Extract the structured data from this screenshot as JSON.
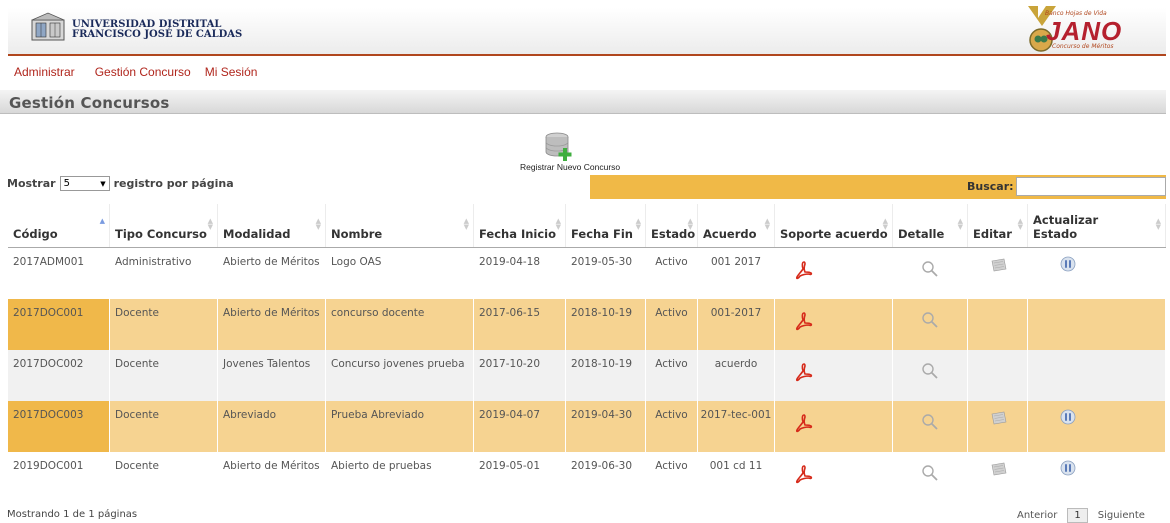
{
  "header": {
    "university_line1": "UNIVERSIDAD DISTRITAL",
    "university_line2": "FRANCISCO JOSÉ DE CALDAS",
    "jano_tagline": "Banco Hojas de Vida",
    "jano_title": "JANO",
    "jano_subtitle": "Concurso de Méritos"
  },
  "menu": {
    "items": [
      "Administrar",
      "Gestión Concurso",
      "Mi Sesión"
    ]
  },
  "section": {
    "title": "Gestión Concursos"
  },
  "register": {
    "label": "Registrar Nuevo Concurso",
    "icon": "database-add-icon"
  },
  "length": {
    "prefix": "Mostrar",
    "value": "5",
    "suffix": "registro por página"
  },
  "search": {
    "label": "Buscar:",
    "value": ""
  },
  "table": {
    "headers": [
      "Código",
      "Tipo Concurso",
      "Modalidad",
      "Nombre",
      "Fecha Inicio",
      "Fecha Fin",
      "Estado",
      "Acuerdo",
      "Soporte acuerdo",
      "Detalle",
      "Editar",
      "Actualizar Estado"
    ],
    "rows": [
      {
        "codigo": "2017ADM001",
        "tipo": "Administrativo",
        "modalidad": "Abierto de Méritos",
        "nombre": "Logo OAS",
        "inicio": "2019-04-18",
        "fin": "2019-05-30",
        "estado": "Activo",
        "acuerdo": "001 2017",
        "editar": true,
        "actualizar": true
      },
      {
        "codigo": "2017DOC001",
        "tipo": "Docente",
        "modalidad": "Abierto de Méritos",
        "nombre": "concurso docente",
        "inicio": "2017-06-15",
        "fin": "2018-10-19",
        "estado": "Activo",
        "acuerdo": "001-2017",
        "editar": false,
        "actualizar": false
      },
      {
        "codigo": "2017DOC002",
        "tipo": "Docente",
        "modalidad": "Jovenes Talentos",
        "nombre": "Concurso jovenes prueba",
        "inicio": "2017-10-20",
        "fin": "2018-10-19",
        "estado": "Activo",
        "acuerdo": "acuerdo",
        "editar": false,
        "actualizar": false
      },
      {
        "codigo": "2017DOC003",
        "tipo": "Docente",
        "modalidad": "Abreviado",
        "nombre": "Prueba Abreviado",
        "inicio": "2019-04-07",
        "fin": "2019-04-30",
        "estado": "Activo",
        "acuerdo": "2017-tec-001",
        "editar": true,
        "actualizar": true
      },
      {
        "codigo": "2019DOC001",
        "tipo": "Docente",
        "modalidad": "Abierto de Méritos",
        "nombre": "Abierto de pruebas",
        "inicio": "2019-05-01",
        "fin": "2019-06-30",
        "estado": "Activo",
        "acuerdo": "001 cd 11",
        "editar": true,
        "actualizar": true
      }
    ]
  },
  "footer": {
    "info": "Mostrando 1 de 1 páginas",
    "prev": "Anterior",
    "page": "1",
    "next": "Siguiente"
  },
  "colors": {
    "accent": "#b0261d",
    "highlight_row": "#f6d391",
    "search_bar": "#f0b947"
  }
}
